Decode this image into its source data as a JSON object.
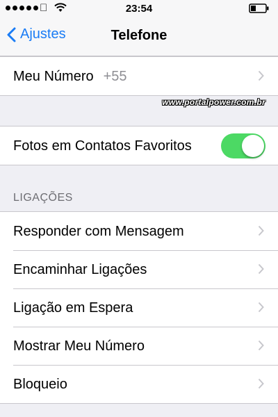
{
  "status_bar": {
    "time": "23:54",
    "signal_dots": 5,
    "carrier_icon": "apple-icon",
    "wifi_icon": "wifi-icon",
    "battery_icon": "battery-icon",
    "battery_level": 0.35
  },
  "nav": {
    "back_label": "Ajustes",
    "title": "Telefone",
    "accent_color": "#1a7cf5"
  },
  "my_number": {
    "label": "Meu Número",
    "value": "+55"
  },
  "watermark": "www.portalpower.com.br",
  "favorites_photos": {
    "label": "Fotos em Contatos Favoritos",
    "enabled": true,
    "toggle_color": "#4cd964"
  },
  "calls_section": {
    "header": "LIGAÇÕES",
    "items": [
      {
        "label": "Responder com Mensagem"
      },
      {
        "label": "Encaminhar Ligações"
      },
      {
        "label": "Ligação em Espera"
      },
      {
        "label": "Mostrar Meu Número"
      },
      {
        "label": "Bloqueio"
      }
    ]
  }
}
